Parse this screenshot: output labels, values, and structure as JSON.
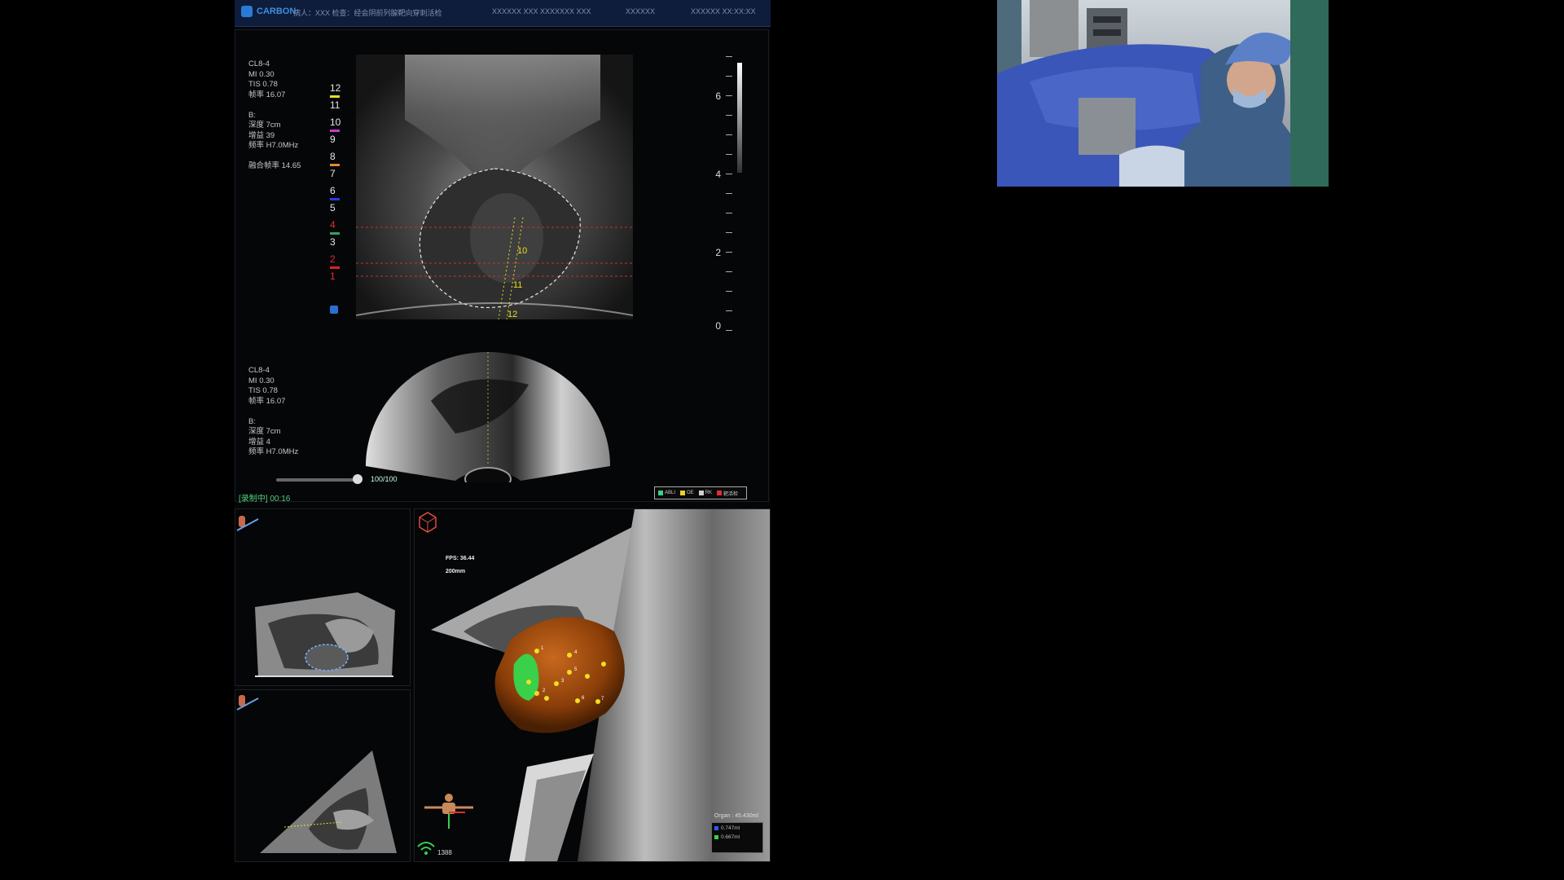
{
  "app": {
    "logo_text": "CARBON",
    "menu": [
      "病人：XXX  检查：经会阴前列腺靶向穿刺活检",
      "XXXXXX  XXX  XXXXXXX  XXX",
      "XXXXXX"
    ],
    "menu_right": "XXXXXX  XX:XX:XX"
  },
  "ultrasound": {
    "top_params": "CL8-4\nMI 0.30\nTIS 0.78\n帧率 16.07\n\nB:\n深度 7cm\n增益 39\n频率 H7.0MHz\n\n融合帧率 14.65",
    "bottom_params": "CL8-4\nMI 0.30\nTIS 0.78\n帧率 16.07\n\nB:\n深度 7cm\n增益 4\n频率 H7.0MHz",
    "grid_numbers": [
      "12",
      "11",
      "10",
      "9",
      "8",
      "7",
      "6",
      "5",
      "4",
      "3",
      "2",
      "1"
    ],
    "grid_colors": [
      "#e8e020",
      "#c83cc8",
      "#e08a30",
      "#2a3ce0",
      "#3aa060",
      "#e02020"
    ],
    "needle_labels": [
      "10",
      "11",
      "12"
    ],
    "depth_labels": [
      "6",
      "4",
      "2",
      "0"
    ],
    "slider_value": "100/100",
    "slider_fraction": 1.0,
    "record_status": "[录制中] 00:16",
    "legend": [
      {
        "label": "ABLI",
        "color": "#3ccf8a"
      },
      {
        "label": "OE",
        "color": "#e6d22a"
      },
      {
        "label": "RK",
        "color": "#cfcfcf"
      },
      {
        "label": "靶活检",
        "color": "#e03030"
      }
    ]
  },
  "volume": {
    "fps": "FPS: 36.44",
    "distance": "200mm",
    "organ_title": "Organ : 45.430ml",
    "organ_rows": [
      "0.747ml",
      "0.667ml"
    ],
    "organ_colors": [
      "#2a5cff",
      "#3ad04a"
    ],
    "signal_value": "1388",
    "point_labels": [
      "1",
      "2",
      "3",
      "4",
      "5",
      "6",
      "7"
    ]
  }
}
